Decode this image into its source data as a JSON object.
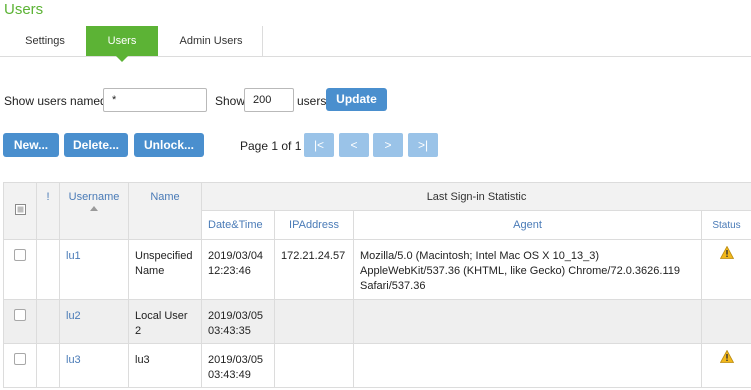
{
  "page": {
    "title": "Users"
  },
  "tabs": [
    {
      "label": "Settings",
      "active": false
    },
    {
      "label": "Users",
      "active": true
    },
    {
      "label": "Admin Users",
      "active": false
    }
  ],
  "filter": {
    "name_label": "Show users named:",
    "name_value": "*",
    "show_label": "Show",
    "count_value": "200",
    "users_label": "users",
    "update_label": "Update"
  },
  "actions": {
    "new_label": "New...",
    "delete_label": "Delete...",
    "unlock_label": "Unlock..."
  },
  "pagination": {
    "text": "Page 1 of 1",
    "first": "|<",
    "prev": "<",
    "next": ">",
    "last": ">|"
  },
  "table": {
    "headers": {
      "flag": "!",
      "username": "Username",
      "name": "Name",
      "group": "Last Sign-in Statistic",
      "datetime": "Date&Time",
      "ip": "IPAddress",
      "agent": "Agent",
      "status": "Status"
    },
    "rows": [
      {
        "username": "lu1",
        "name": "Unspecified Name",
        "date": "2019/03/04",
        "time": "12:23:46",
        "ip": "172.21.24.57",
        "agent": "Mozilla/5.0 (Macintosh; Intel Mac OS X 10_13_3) AppleWebKit/537.36 (KHTML, like Gecko) Chrome/72.0.3626.119 Safari/537.36",
        "status_icon": "warning-icon"
      },
      {
        "username": "lu2",
        "name": "Local User 2",
        "date": "2019/03/05",
        "time": "03:43:35",
        "ip": "",
        "agent": "",
        "status_icon": ""
      },
      {
        "username": "lu3",
        "name": "lu3",
        "date": "2019/03/05",
        "time": "03:43:49",
        "ip": "",
        "agent": "",
        "status_icon": "warning-icon"
      }
    ]
  },
  "colors": {
    "accent_green": "#5cb335",
    "button_blue": "#4a8fce",
    "disabled_blue": "#9ac3e8",
    "link_blue": "#4a7bb7",
    "warning": "#f2b81c"
  }
}
